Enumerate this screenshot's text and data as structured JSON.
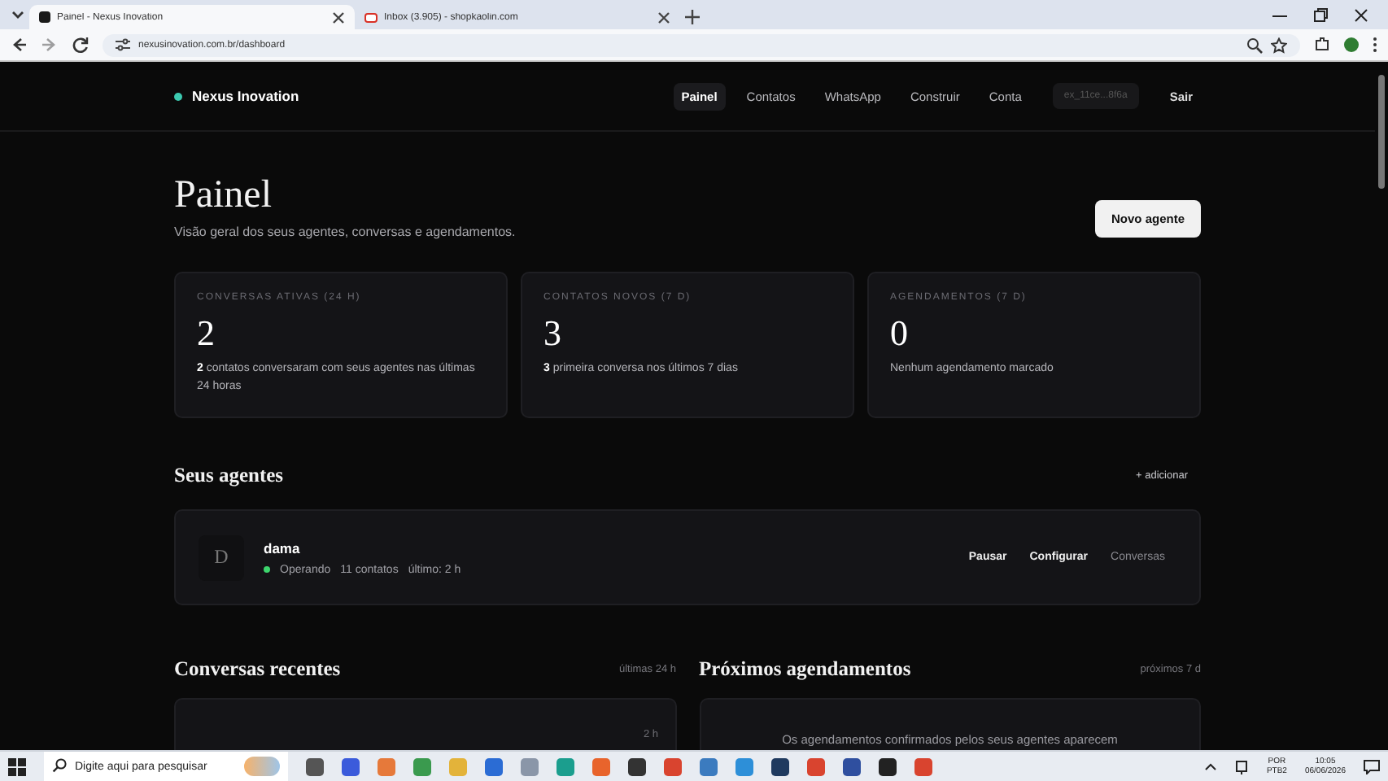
{
  "browser": {
    "tabs": [
      {
        "title": "Painel - Nexus Inovation",
        "selected": true
      },
      {
        "title": "Inbox (3.905) - shopkaolin.com",
        "selected": false
      }
    ],
    "address": "nexusinovation.com.br/dashboard"
  },
  "header": {
    "brand": "Nexus Inovation",
    "nav": [
      {
        "label": "Painel",
        "selected": true
      },
      {
        "label": "Contatos",
        "selected": false
      },
      {
        "label": "WhatsApp",
        "selected": false
      },
      {
        "label": "Construir",
        "selected": false
      },
      {
        "label": "Conta",
        "selected": false
      }
    ],
    "account": "ex_11ce...8f6a",
    "logout": "Sair"
  },
  "page": {
    "title": "Painel",
    "subtitle": "Visão geral dos seus agentes, conversas e agendamentos.",
    "primary_button": "Novo agente"
  },
  "stats": [
    {
      "label": "CONVERSAS ATIVAS (24 H)",
      "value": "2",
      "note": "**2** contatos conversaram com seus agentes nas últimas 24 horas"
    },
    {
      "label": "CONTATOS NOVOS (7 D)",
      "value": "3",
      "note": "**3** primeira conversa nos últimos 7 dias"
    },
    {
      "label": "AGENDAMENTOS (7 D)",
      "value": "0",
      "note": "Nenhum agendamento marcado"
    }
  ],
  "agents_section": {
    "title": "Seus agentes",
    "action": "+ adicionar",
    "agents": [
      {
        "initial": "D",
        "name": "dama",
        "online": true,
        "status": "Operando",
        "contacts": "11 contatos",
        "last": "último: 2 h",
        "actions": [
          "Pausar",
          "Configurar",
          "Conversas"
        ]
      }
    ]
  },
  "recent": {
    "title": "Conversas recentes",
    "range": "últimas 24 h",
    "items": [
      {
        "time": "2 h"
      }
    ]
  },
  "upcoming": {
    "title": "Próximos agendamentos",
    "range": "próximos 7 d",
    "empty": "Os agendamentos confirmados pelos seus agentes aparecem"
  },
  "taskbar": {
    "search": "Digite aqui para pesquisar",
    "language": "POR",
    "layout": "PTB2",
    "time": "10:05",
    "date": "06/06/2026"
  }
}
